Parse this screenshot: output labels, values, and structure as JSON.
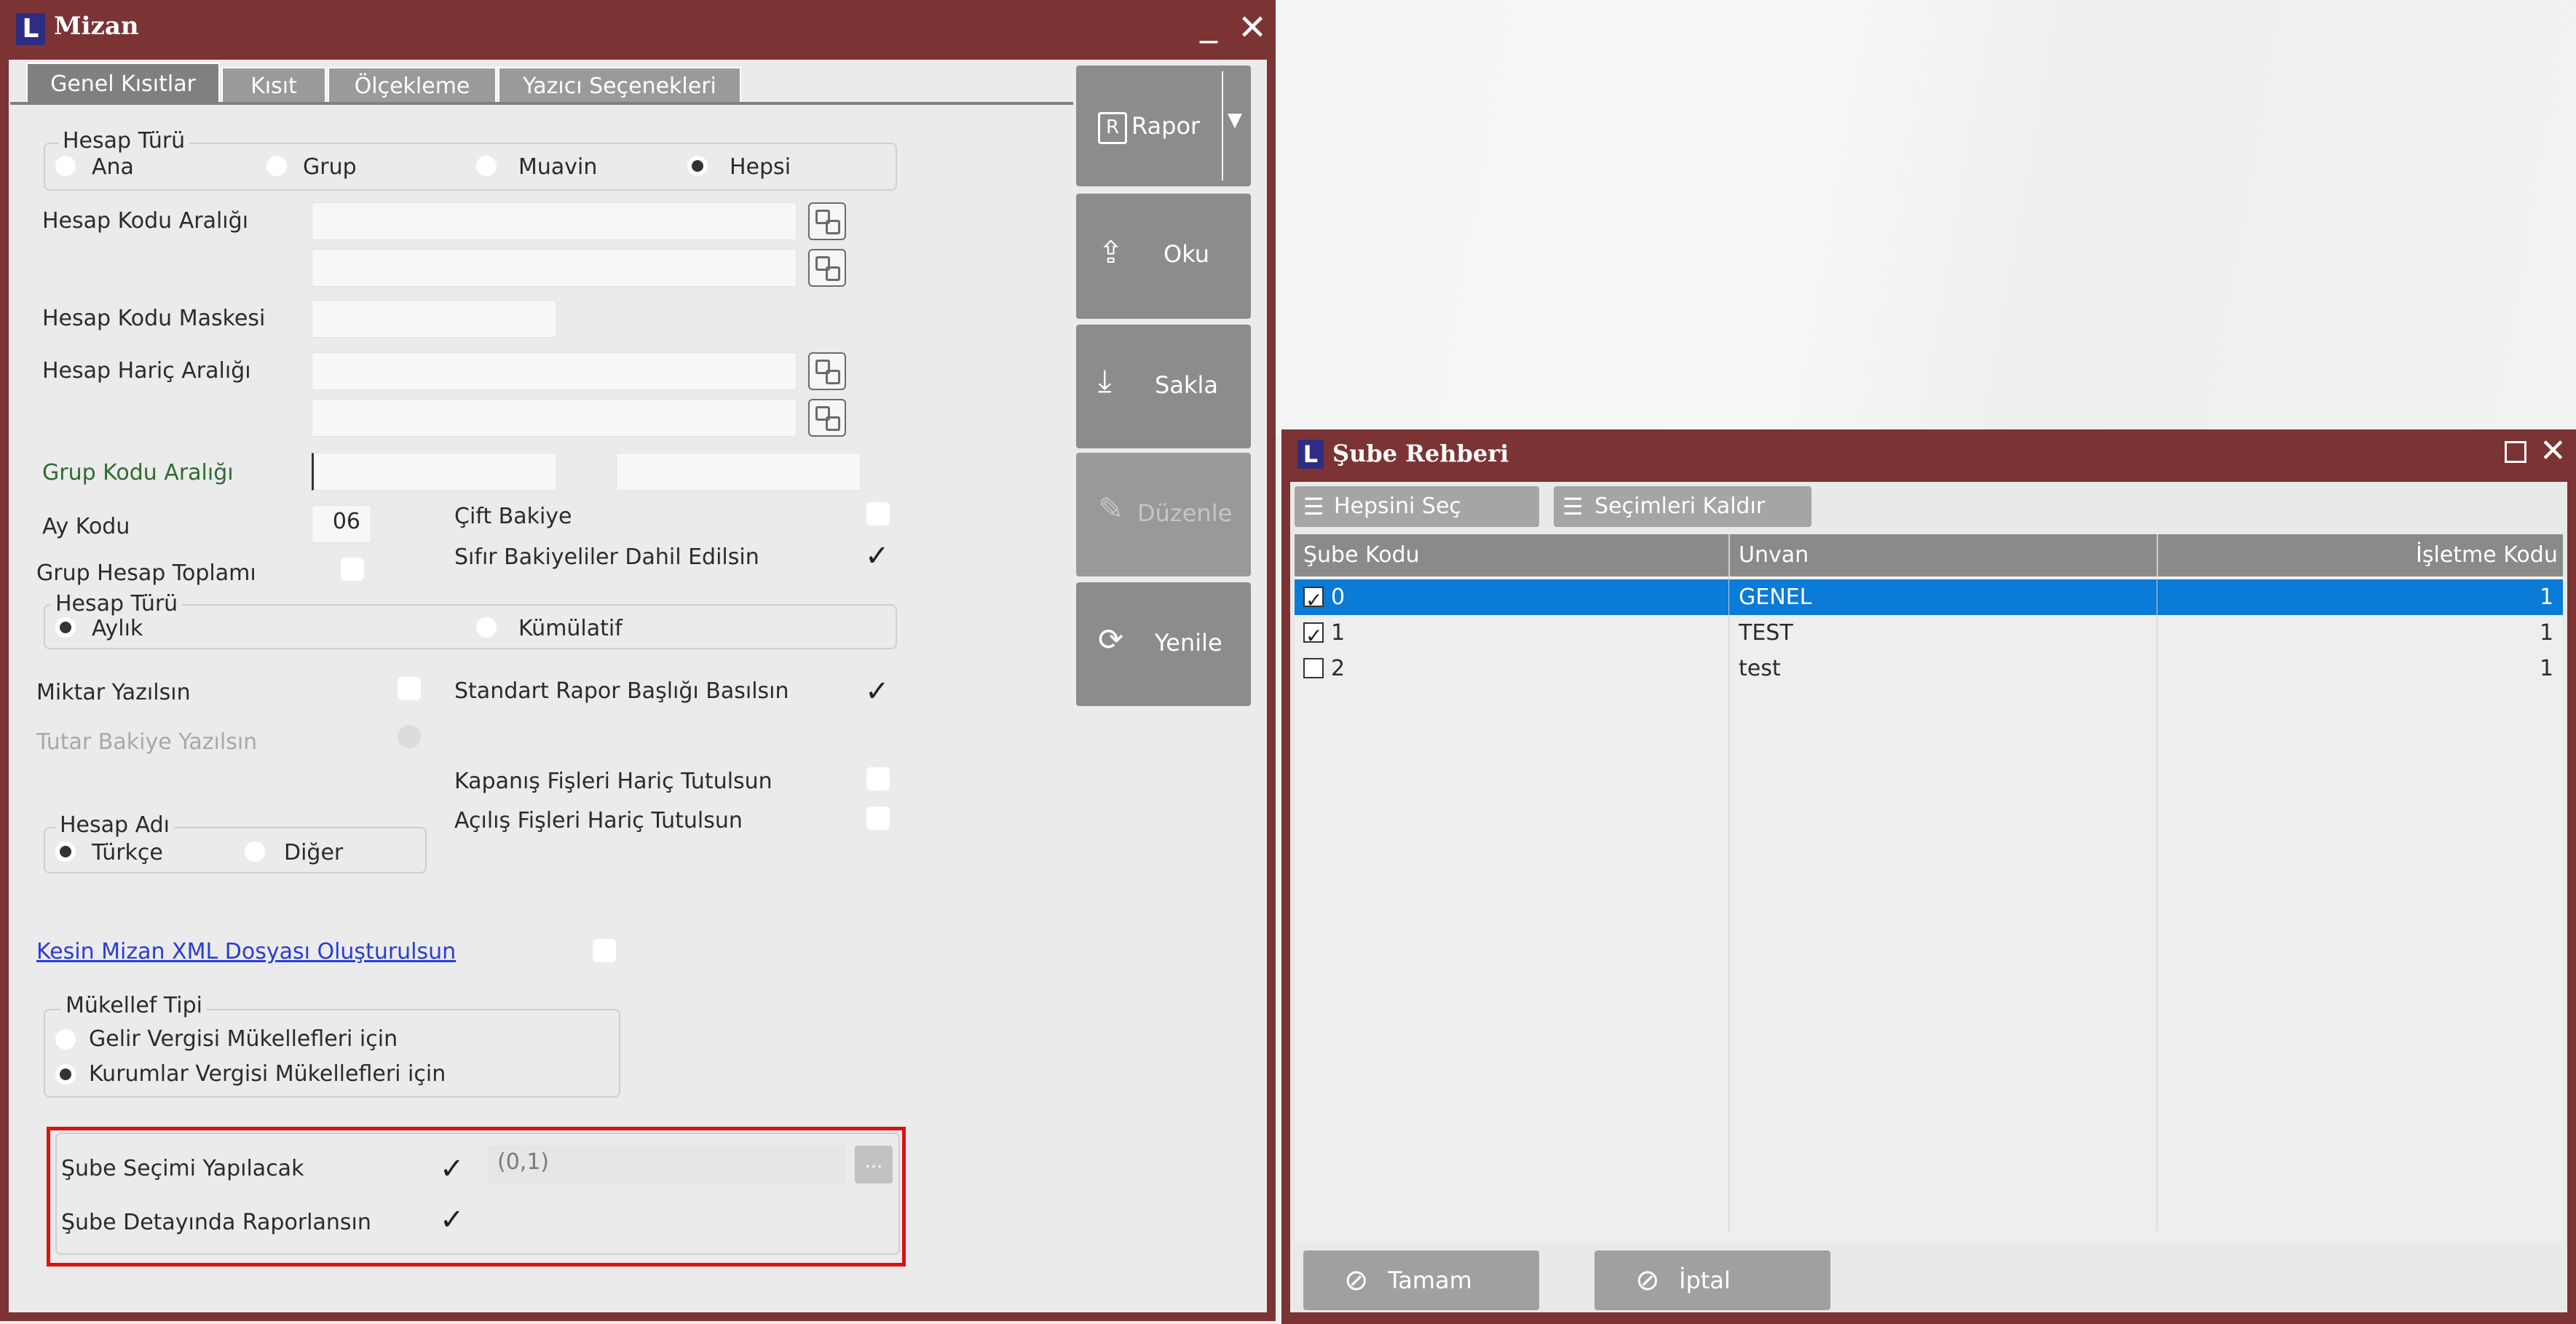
{
  "mizan": {
    "title": "Mizan",
    "logo": "L",
    "tabs": [
      "Genel Kısıtlar",
      "Kısıt",
      "Ölçekleme",
      "Yazıcı Seçenekleri"
    ],
    "hesap_turu": {
      "title": "Hesap Türü",
      "options": [
        "Ana",
        "Grup",
        "Muavin",
        "Hepsi"
      ],
      "selected": "Hepsi"
    },
    "hesap_kodu_araligi": "Hesap Kodu Aralığı",
    "hesap_kodu_maskesi": "Hesap Kodu Maskesi",
    "hesap_haric_araligi": "Hesap Hariç Aralığı",
    "grup_kodu_araligi": "Grup Kodu Aralığı",
    "ay_kodu": {
      "label": "Ay Kodu",
      "value": "06"
    },
    "grup_hesap_toplami": "Grup Hesap Toplamı",
    "cift_bakiye": "Çift Bakiye",
    "sifir_bakiyeler": "Sıfır Bakiyeliler Dahil Edilsin",
    "donem_turu": {
      "title": "Hesap Türü",
      "options": [
        "Aylık",
        "Kümülatif"
      ],
      "selected": "Aylık"
    },
    "miktar_yazilsin": "Miktar Yazılsın",
    "tutar_bakiye": "Tutar Bakiye Yazılsın",
    "standart_rapor": "Standart Rapor Başlığı Basılsın",
    "kapanis": "Kapanış Fişleri Hariç Tutulsun",
    "acilis": "Açılış Fişleri Hariç Tutulsun",
    "hesap_adi": {
      "title": "Hesap Adı",
      "options": [
        "Türkçe",
        "Diğer"
      ],
      "selected": "Türkçe"
    },
    "xml_link": "Kesin Mizan XML Dosyası Oluşturulsun",
    "mukellef": {
      "title": "Mükellef Tipi",
      "options": [
        "Gelir Vergisi Mükellefleri için",
        "Kurumlar Vergisi Mükellefleri için"
      ],
      "selected": "Kurumlar Vergisi Mükellefleri için"
    },
    "sube_secimi": {
      "label": "Şube Seçimi Yapılacak",
      "value": "(0,1)",
      "ellipsis": "..."
    },
    "sube_detay": "Şube Detayında Raporlansın",
    "side_buttons": [
      "Rapor",
      "Oku",
      "Sakla",
      "Düzenle",
      "Yenile"
    ],
    "rapor_icon": "R",
    "check": "✓"
  },
  "sube": {
    "title": "Şube Rehberi",
    "logo": "L",
    "toolbar": {
      "select_all": "Hepsini Seç",
      "clear": "Seçimleri Kaldır"
    },
    "columns": [
      "Şube Kodu",
      "Unvan",
      "İşletme Kodu"
    ],
    "rows": [
      {
        "kod": "0",
        "unvan": "GENEL",
        "isletme": "1"
      },
      {
        "kod": "1",
        "unvan": "TEST",
        "isletme": "1"
      },
      {
        "kod": "2",
        "unvan": "test",
        "isletme": "1"
      }
    ],
    "ok": "Tamam",
    "cancel": "İptal"
  },
  "colors": {
    "title_bar": "#7b3334",
    "selection": "#0a7bd6",
    "highlight": "#e01010"
  }
}
